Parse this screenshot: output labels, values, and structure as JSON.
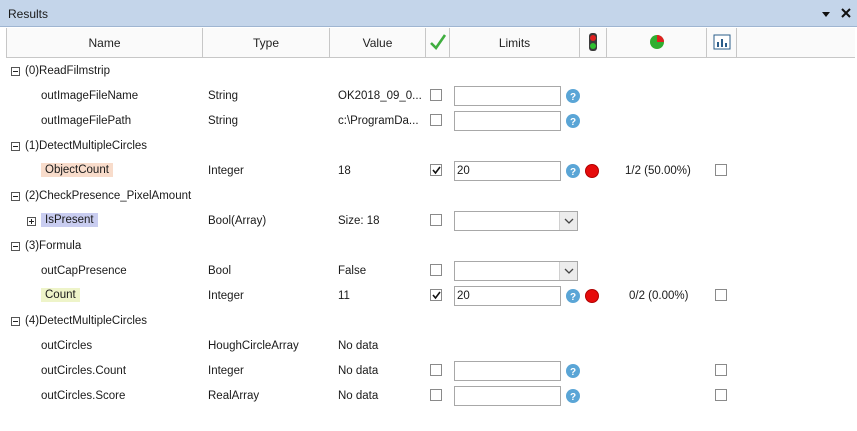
{
  "panel": {
    "title": "Results"
  },
  "columns": {
    "name": "Name",
    "type": "Type",
    "value": "Value",
    "limits": "Limits",
    "check_icon": "green-checkmark-icon",
    "status_icon": "traffic-light-icon",
    "pie_icon": "pie-chart-icon",
    "stats_icon": "statistics-chart-icon"
  },
  "groups": [
    {
      "label": "(0)ReadFilmstrip"
    },
    {
      "label": "(1)DetectMultipleCircles"
    },
    {
      "label": "(2)CheckPresence_PixelAmount"
    },
    {
      "label": "(3)Formula"
    },
    {
      "label": "(4)DetectMultipleCircles"
    }
  ],
  "rows": [
    {
      "name": "outImageFileName",
      "type": "String",
      "value": "OK2018_09_0...",
      "checked": false,
      "limit": ""
    },
    {
      "name": "outImageFilePath",
      "type": "String",
      "value": "c:\\ProgramDa...",
      "checked": false,
      "limit": ""
    },
    {
      "name": "ObjectCount",
      "type": "Integer",
      "value": "18",
      "checked": true,
      "limit": "20",
      "ratio": "1/2 (50.00%)",
      "highlight": "#f8dccb"
    },
    {
      "name": "IsPresent",
      "type": "Bool(Array)",
      "value": "Size: 18",
      "checked": false,
      "limit": "",
      "highlight": "#c9cdf0"
    },
    {
      "name": "outCapPresence",
      "type": "Bool",
      "value": "False",
      "checked": false,
      "limit": ""
    },
    {
      "name": "Count",
      "type": "Integer",
      "value": "11",
      "checked": true,
      "limit": "20",
      "ratio": "0/2 (0.00%)",
      "highlight": "#eef4c9"
    },
    {
      "name": "outCircles",
      "type": "HoughCircleArray",
      "value": "No data"
    },
    {
      "name": "outCircles.Count",
      "type": "Integer",
      "value": "No data",
      "checked": false,
      "limit": ""
    },
    {
      "name": "outCircles.Score",
      "type": "RealArray",
      "value": "No data",
      "checked": false,
      "limit": ""
    }
  ],
  "colors": {
    "titlebar": "#c4d5ea",
    "status_red": "#e60b0b",
    "info_blue": "#5aa5d6",
    "check_green": "#3fae3f"
  }
}
